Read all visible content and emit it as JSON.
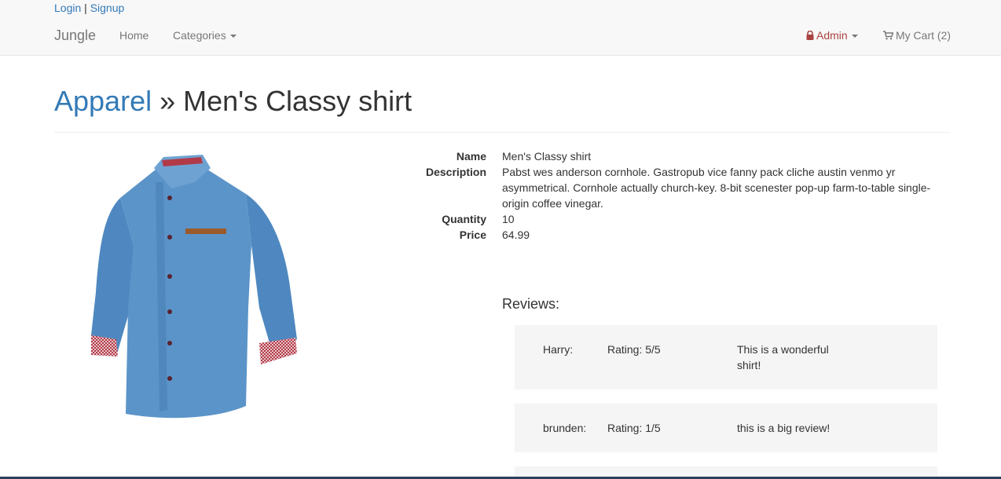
{
  "auth": {
    "login": "Login",
    "separator": "|",
    "signup": "Signup"
  },
  "nav": {
    "brand": "Jungle",
    "home": "Home",
    "categories": "Categories",
    "admin": "Admin",
    "cart": "My Cart (2)"
  },
  "header": {
    "category": "Apparel",
    "separator": "»",
    "product": "Men's Classy shirt"
  },
  "product": {
    "labels": {
      "name": "Name",
      "description": "Description",
      "quantity": "Quantity",
      "price": "Price"
    },
    "name": "Men's Classy shirt",
    "description": "Pabst wes anderson cornhole. Gastropub vice fanny pack cliche austin venmo yr asymmetrical. Cornhole actually church-key. 8-bit scenester pop-up farm-to-table single-origin coffee vinegar.",
    "quantity": "10",
    "price": "64.99"
  },
  "reviews": {
    "title": "Reviews:",
    "items": [
      {
        "name": "Harry:",
        "rating": "Rating: 5/5",
        "text": "This is a wonderful shirt!"
      },
      {
        "name": "brunden:",
        "rating": "Rating: 1/5",
        "text": "this is a big review!"
      }
    ]
  },
  "icons": {
    "admin": "lock-icon",
    "cart": "shopping-cart-icon",
    "categories": "caret-down-icon"
  },
  "colors": {
    "link": "#337ab7",
    "admin": "#a94442",
    "navbar": "#f8f8f8",
    "review_bg": "#f5f5f5",
    "shirt": "#5b94c8"
  }
}
